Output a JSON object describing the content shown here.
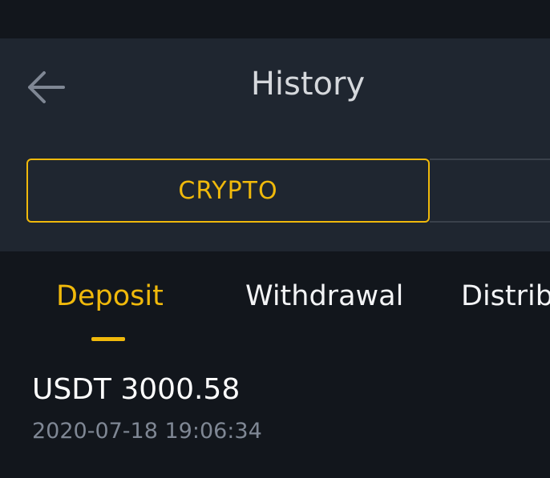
{
  "header": {
    "title": "History"
  },
  "segments": {
    "active_label": "CRYPTO"
  },
  "tabs": [
    {
      "label": "Deposit",
      "active": true
    },
    {
      "label": "Withdrawal",
      "active": false
    },
    {
      "label": "Distrib",
      "active": false
    }
  ],
  "records": [
    {
      "amount": "USDT 3000.58",
      "time": "2020-07-18 19:06:34"
    }
  ],
  "colors": {
    "accent": "#f0b90b",
    "header_bg": "#1f2630",
    "page_bg": "#12161c"
  }
}
